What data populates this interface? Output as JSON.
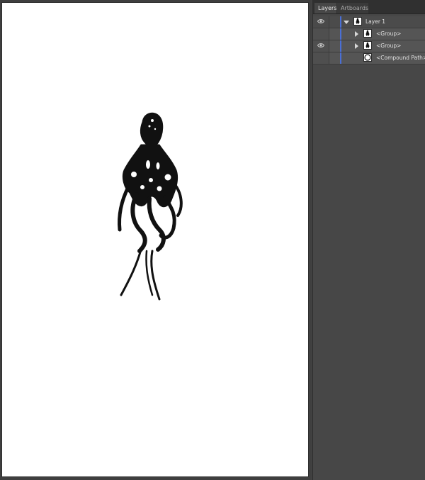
{
  "panel": {
    "tabs": [
      {
        "label": "Layers",
        "active": true
      },
      {
        "label": "Artboards",
        "active": false
      }
    ],
    "layers": [
      {
        "name": "Layer 1",
        "visible": true,
        "expanded": true,
        "level": 0,
        "icon": "octopus-thumbnail-icon"
      },
      {
        "name": "<Group>",
        "visible": false,
        "expanded": false,
        "level": 1,
        "icon": "octopus-thumbnail-icon"
      },
      {
        "name": "<Group>",
        "visible": true,
        "expanded": false,
        "level": 1,
        "icon": "octopus-thumbnail-icon"
      },
      {
        "name": "<Compound Path>",
        "visible": false,
        "expanded": false,
        "level": 1,
        "icon": "circle-thumbnail-icon"
      }
    ],
    "layer_color": "#4a6fd6"
  },
  "canvas": {
    "artwork_icon": "octopus-ink-illustration",
    "artboard_color": "#ffffff"
  }
}
